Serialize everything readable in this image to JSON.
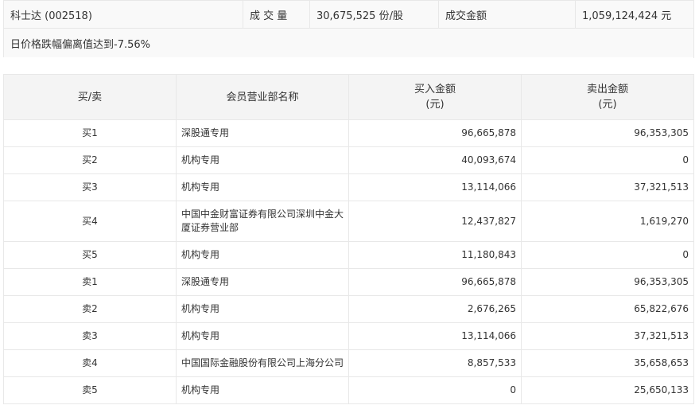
{
  "summary": {
    "stock_name": "科士达 (002518)",
    "volume_label": "成 交 量",
    "volume_value": "30,675,525 份/股",
    "turnover_label": "成交金额",
    "turnover_value": "1,059,124,424 元",
    "reason": "日价格跌幅偏离值达到-7.56%"
  },
  "table": {
    "headers": {
      "side": "买/卖",
      "broker": "会员营业部名称",
      "buy_amount": "买入金额",
      "buy_unit": "(元)",
      "sell_amount": "卖出金额",
      "sell_unit": "(元)"
    },
    "rows": [
      {
        "side": "买1",
        "broker": "深股通专用",
        "buy": "96,665,878",
        "sell": "96,353,305"
      },
      {
        "side": "买2",
        "broker": "机构专用",
        "buy": "40,093,674",
        "sell": "0"
      },
      {
        "side": "买3",
        "broker": "机构专用",
        "buy": "13,114,066",
        "sell": "37,321,513"
      },
      {
        "side": "买4",
        "broker": "中国中金财富证券有限公司深圳中金大厦证券营业部",
        "buy": "12,437,827",
        "sell": "1,619,270"
      },
      {
        "side": "买5",
        "broker": "机构专用",
        "buy": "11,180,843",
        "sell": "0"
      },
      {
        "side": "卖1",
        "broker": "深股通专用",
        "buy": "96,665,878",
        "sell": "96,353,305"
      },
      {
        "side": "卖2",
        "broker": "机构专用",
        "buy": "2,676,265",
        "sell": "65,822,676"
      },
      {
        "side": "卖3",
        "broker": "机构专用",
        "buy": "13,114,066",
        "sell": "37,321,513"
      },
      {
        "side": "卖4",
        "broker": "中国国际金融股份有限公司上海分公司",
        "buy": "8,857,533",
        "sell": "35,658,653"
      },
      {
        "side": "卖5",
        "broker": "机构专用",
        "buy": "0",
        "sell": "25,650,133"
      }
    ]
  }
}
